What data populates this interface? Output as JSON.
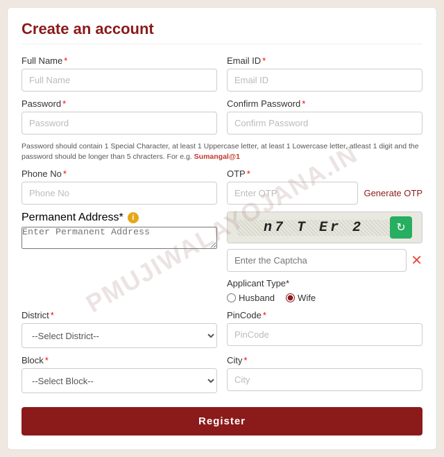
{
  "page": {
    "title": "Create an account",
    "watermark": "PMUJIWALAYOJANA.IN"
  },
  "fields": {
    "full_name": {
      "label": "Full Name",
      "placeholder": "Full Name",
      "required": true
    },
    "email_id": {
      "label": "Email ID",
      "placeholder": "Email ID",
      "required": true
    },
    "password": {
      "label": "Password",
      "placeholder": "Password",
      "required": true
    },
    "confirm_password": {
      "label": "Confirm Password",
      "placeholder": "Confirm Password",
      "required": true
    },
    "password_hint": "Password should contain 1 Special Character, at least 1 Uppercase letter, at least 1 Lowercase letter, atleast 1 digit and the password should be longer than 5 chracters. For e.g.",
    "password_example": "Sumangal@1",
    "phone_no": {
      "label": "Phone No",
      "placeholder": "Phone No",
      "required": true
    },
    "otp": {
      "label": "OTP",
      "placeholder": "Enter OTP",
      "required": true
    },
    "generate_otp": "Generate OTP",
    "permanent_address": {
      "label": "Permanent Address",
      "placeholder": "Enter Permanent Address",
      "required": true
    },
    "captcha_value": "n7 T Er 2",
    "captcha_input": {
      "placeholder": "Enter the Captcha"
    },
    "applicant_type": {
      "label": "Applicant Type",
      "required": true,
      "options": [
        "Husband",
        "Wife"
      ],
      "selected": "Wife"
    },
    "district": {
      "label": "District",
      "placeholder": "--Select District--",
      "required": true
    },
    "block": {
      "label": "Block",
      "placeholder": "--Select Block--",
      "required": true
    },
    "pincode": {
      "label": "PinCode",
      "placeholder": "PinCode",
      "required": true
    },
    "city": {
      "label": "City",
      "placeholder": "City",
      "required": true
    }
  },
  "buttons": {
    "register": "Register",
    "generate_otp": "Generate OTP",
    "refresh_captcha": "↻",
    "clear_captcha": "✕"
  }
}
